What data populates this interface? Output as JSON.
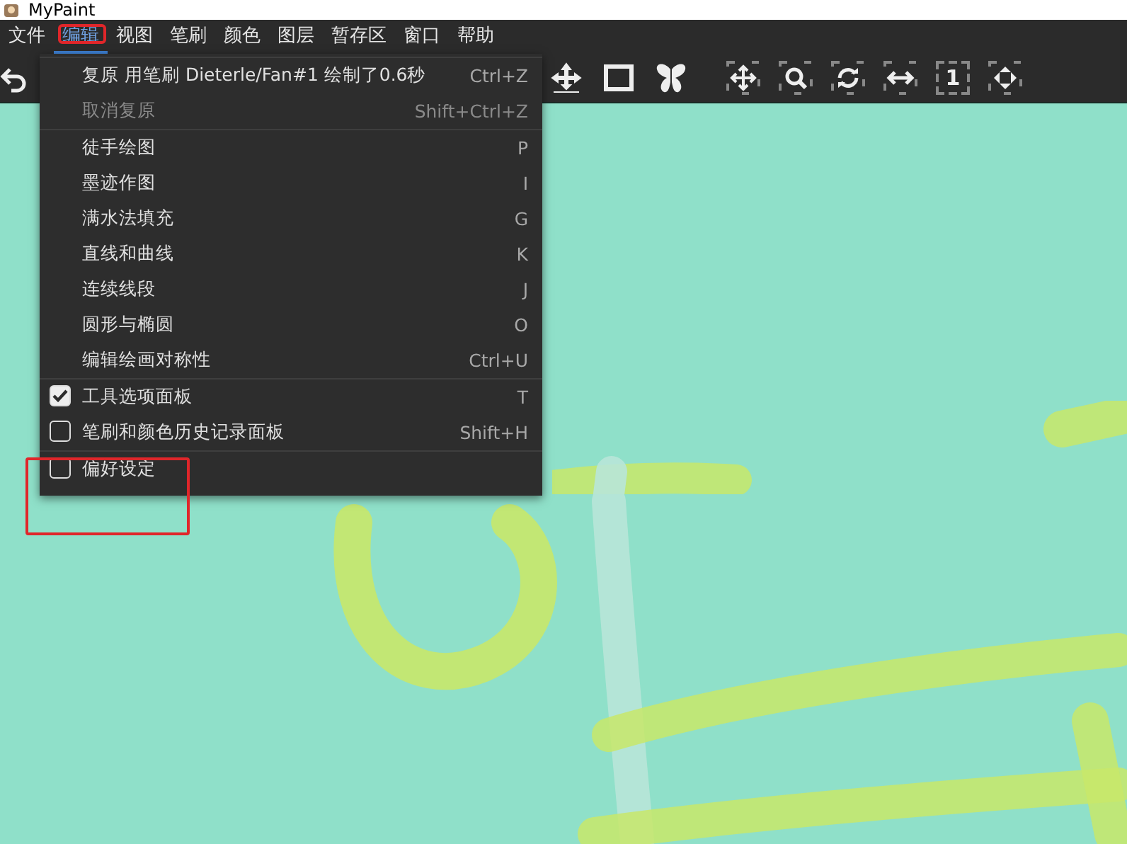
{
  "window": {
    "title": "MyPaint"
  },
  "menubar": [
    {
      "label": "文件",
      "selected": false
    },
    {
      "label": "编辑",
      "selected": true
    },
    {
      "label": "视图",
      "selected": false
    },
    {
      "label": "笔刷",
      "selected": false
    },
    {
      "label": "颜色",
      "selected": false
    },
    {
      "label": "图层",
      "selected": false
    },
    {
      "label": "暂存区",
      "selected": false
    },
    {
      "label": "窗口",
      "selected": false
    },
    {
      "label": "帮助",
      "selected": false
    }
  ],
  "toolbar": {
    "one_to_one_zoom_label": "1"
  },
  "edit_menu": {
    "groups": [
      [
        {
          "kind": "action",
          "label": "复原 用笔刷 Dieterle/Fan#1 绘制了0.6秒",
          "shortcut": "Ctrl+Z",
          "disabled": false
        },
        {
          "kind": "action",
          "label": "取消复原",
          "shortcut": "Shift+Ctrl+Z",
          "disabled": true
        }
      ],
      [
        {
          "kind": "action",
          "label": "徒手绘图",
          "shortcut": "P",
          "disabled": false
        },
        {
          "kind": "action",
          "label": "墨迹作图",
          "shortcut": "I",
          "disabled": false
        },
        {
          "kind": "action",
          "label": "满水法填充",
          "shortcut": "G",
          "disabled": false
        },
        {
          "kind": "action",
          "label": "直线和曲线",
          "shortcut": "K",
          "disabled": false
        },
        {
          "kind": "action",
          "label": "连续线段",
          "shortcut": "J",
          "disabled": false
        },
        {
          "kind": "action",
          "label": "圆形与椭圆",
          "shortcut": "O",
          "disabled": false
        },
        {
          "kind": "action",
          "label": "编辑绘画对称性",
          "shortcut": "Ctrl+U",
          "disabled": false
        }
      ],
      [
        {
          "kind": "check",
          "label": "工具选项面板",
          "shortcut": "T",
          "checked": true
        },
        {
          "kind": "check",
          "label": "笔刷和颜色历史记录面板",
          "shortcut": "Shift+H",
          "checked": false
        }
      ],
      [
        {
          "kind": "check",
          "label": "偏好设定",
          "checked": false
        }
      ]
    ]
  }
}
